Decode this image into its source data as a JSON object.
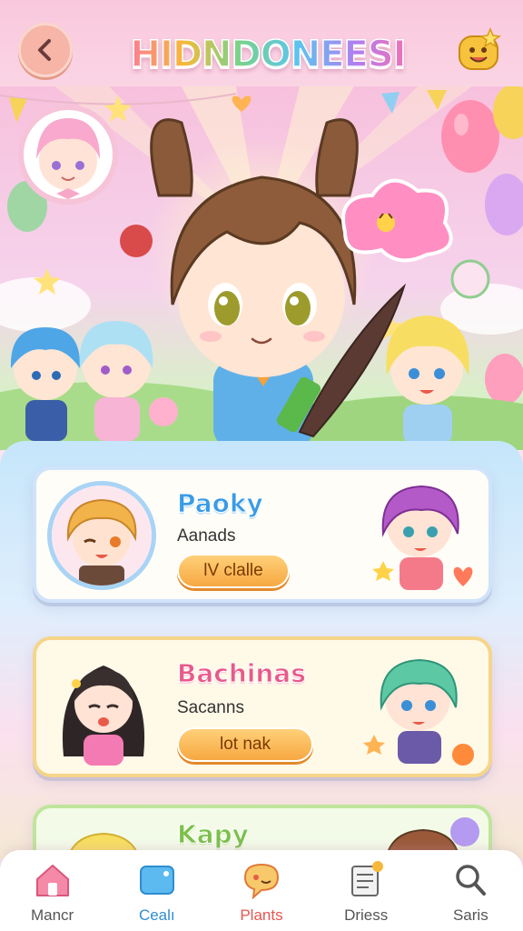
{
  "header": {
    "title": "HIDNDONEESI",
    "back_icon": "chevron-left-icon",
    "mascot_icon": "smiley-mascot-icon"
  },
  "cards": [
    {
      "name": "Paoky",
      "subtitle": "Aanads",
      "button_label": "lV clalle",
      "accent": "#3a9be6"
    },
    {
      "name": "Bachinas",
      "subtitle": "Sacanns",
      "button_label": "lot nak",
      "accent": "#e85a8a"
    },
    {
      "name": "Kapy",
      "accent": "#7cc04a"
    }
  ],
  "nav": {
    "items": [
      {
        "label": "Mancr",
        "icon": "home-icon"
      },
      {
        "label": "Cealı",
        "icon": "card-icon"
      },
      {
        "label": "Plants",
        "icon": "speech-bubble-icon",
        "active": true
      },
      {
        "label": "Driess",
        "icon": "document-icon"
      },
      {
        "label": "Saris",
        "icon": "search-icon"
      }
    ]
  },
  "colors": {
    "header_bg": "#f9c8dc",
    "active_nav": "#e8554f",
    "button_orange": "#f7a842"
  }
}
